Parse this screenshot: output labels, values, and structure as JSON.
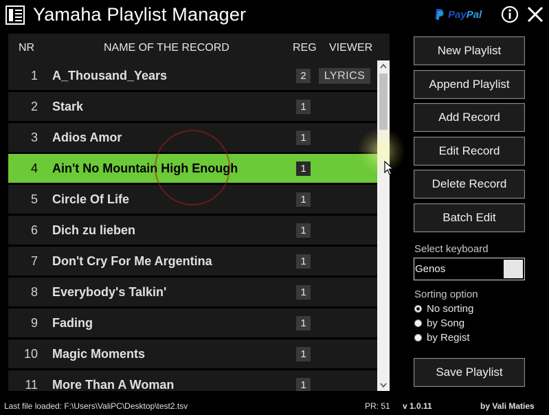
{
  "app": {
    "title": "Yamaha Playlist Manager",
    "paypal_pay": "Pay",
    "paypal_pal": "Pal"
  },
  "table": {
    "headers": {
      "nr": "NR",
      "name": "NAME OF THE RECORD",
      "reg": "REG",
      "viewer": "VIEWER"
    },
    "rows": [
      {
        "nr": "1",
        "name": "A_Thousand_Years",
        "reg": "2",
        "viewer": "LYRICS",
        "selected": false
      },
      {
        "nr": "2",
        "name": "Stark",
        "reg": "1",
        "viewer": "",
        "selected": false
      },
      {
        "nr": "3",
        "name": "Adios Amor",
        "reg": "1",
        "viewer": "",
        "selected": false
      },
      {
        "nr": "4",
        "name": "Ain't No Mountain High Enough",
        "reg": "1",
        "viewer": "",
        "selected": true
      },
      {
        "nr": "5",
        "name": "Circle Of Life",
        "reg": "1",
        "viewer": "",
        "selected": false
      },
      {
        "nr": "6",
        "name": "Dich zu lieben",
        "reg": "1",
        "viewer": "",
        "selected": false
      },
      {
        "nr": "7",
        "name": "Don't Cry For Me Argentina",
        "reg": "1",
        "viewer": "",
        "selected": false
      },
      {
        "nr": "8",
        "name": "Everybody's Talkin'",
        "reg": "1",
        "viewer": "",
        "selected": false
      },
      {
        "nr": "9",
        "name": "Fading",
        "reg": "1",
        "viewer": "",
        "selected": false
      },
      {
        "nr": "10",
        "name": "Magic Moments",
        "reg": "1",
        "viewer": "",
        "selected": false
      },
      {
        "nr": "11",
        "name": "More Than A Woman",
        "reg": "1",
        "viewer": "",
        "selected": false
      }
    ]
  },
  "sidebar": {
    "buttons": [
      "New Playlist",
      "Append Playlist",
      "Add Record",
      "Edit Record",
      "Delete Record",
      "Batch Edit"
    ],
    "keyboard_label": "Select keyboard",
    "keyboard_value": "Genos",
    "sorting_label": "Sorting option",
    "sorting_options": [
      {
        "label": "No sorting",
        "checked": true
      },
      {
        "label": "by Song",
        "checked": false
      },
      {
        "label": "by Regist",
        "checked": false
      }
    ],
    "save_button": "Save Playlist"
  },
  "status": {
    "last_file": "Last file loaded: F:\\Users\\ValiPC\\Desktop\\test2.tsv",
    "pr": "PR: 51",
    "version": "v 1.0.11",
    "author": "by Vali Maties"
  },
  "colors": {
    "selected_row": "#6cc938",
    "row_bg": "#1a1a1a",
    "paypal_dark": "#1e4fbd",
    "paypal_light": "#2b9ee6"
  }
}
